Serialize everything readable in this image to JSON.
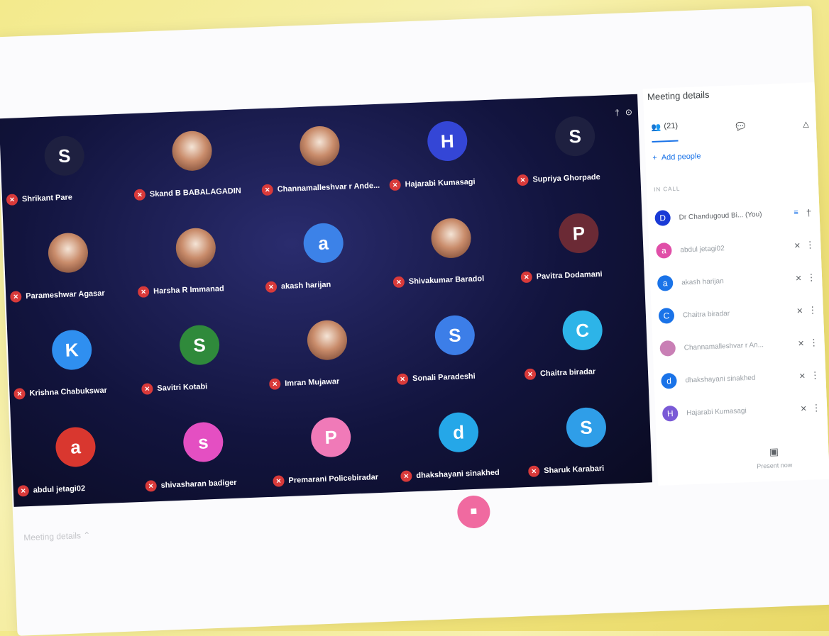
{
  "tiles": [
    {
      "name": "Shrikant Pare",
      "initial": "S",
      "color": "#1e2040",
      "photo": false
    },
    {
      "name": "Skand B BABALAGADIN",
      "initial": "",
      "color": "",
      "photo": true
    },
    {
      "name": "Channamalleshvar r Ande...",
      "initial": "",
      "color": "",
      "photo": true
    },
    {
      "name": "Hajarabi Kumasagi",
      "initial": "H",
      "color": "#3446d6",
      "photo": false
    },
    {
      "name": "Supriya Ghorpade",
      "initial": "S",
      "color": "#1e2040",
      "photo": false
    },
    {
      "name": "Parameshwar Agasar",
      "initial": "",
      "color": "",
      "photo": true
    },
    {
      "name": "Harsha R Immanad",
      "initial": "",
      "color": "",
      "photo": true
    },
    {
      "name": "akash harijan",
      "initial": "a",
      "color": "#3c82e8",
      "photo": false
    },
    {
      "name": "Shivakumar Baradol",
      "initial": "",
      "color": "",
      "photo": true
    },
    {
      "name": "Pavitra Dodamani",
      "initial": "P",
      "color": "#6b2a35",
      "photo": false
    },
    {
      "name": "Krishna Chabukswar",
      "initial": "K",
      "color": "#2f8ff0",
      "photo": false
    },
    {
      "name": "Savitri Kotabi",
      "initial": "S",
      "color": "#2f8a3b",
      "photo": false
    },
    {
      "name": "Imran Mujawar",
      "initial": "",
      "color": "",
      "photo": true
    },
    {
      "name": "Sonali Paradeshi",
      "initial": "S",
      "color": "#3c7ee8",
      "photo": false
    },
    {
      "name": "Chaitra biradar",
      "initial": "C",
      "color": "#2db4e8",
      "photo": false
    },
    {
      "name": "abdul jetagi02",
      "initial": "a",
      "color": "#d9372f",
      "photo": false
    },
    {
      "name": "shivasharan badiger",
      "initial": "s",
      "color": "#e44fc2",
      "photo": false
    },
    {
      "name": "Premarani Policebiradar",
      "initial": "P",
      "color": "#f07ab8",
      "photo": false
    },
    {
      "name": "dhakshayani sinakhed",
      "initial": "d",
      "color": "#25a7e8",
      "photo": false
    },
    {
      "name": "Sharuk Karabari",
      "initial": "S",
      "color": "#2f9ee8",
      "photo": false
    }
  ],
  "panel": {
    "title": "Meeting details",
    "people_count": "(21)",
    "add_people": "Add people",
    "section": "IN CALL",
    "present_label": "Present now",
    "participants": [
      {
        "name": "Dr Chandugoud Bi... (You)",
        "initial": "D",
        "color": "#1a3ad6"
      },
      {
        "name": "abdul jetagi02",
        "initial": "a",
        "color": "#e04fa8"
      },
      {
        "name": "akash harijan",
        "initial": "a",
        "color": "#1a73e8"
      },
      {
        "name": "Chaitra biradar",
        "initial": "C",
        "color": "#1a73e8"
      },
      {
        "name": "Channamalleshvar r An...",
        "initial": "",
        "color": "#c97fb5"
      },
      {
        "name": "dhakshayani sinakhed",
        "initial": "d",
        "color": "#1a73e8"
      },
      {
        "name": "Hajarabi Kumasagi",
        "initial": "H",
        "color": "#7a5ad6"
      }
    ]
  },
  "footer": {
    "meeting_details": "Meeting details"
  }
}
